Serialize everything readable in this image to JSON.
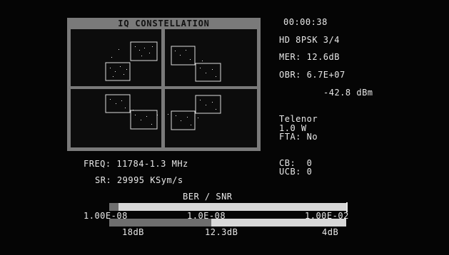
{
  "panel": {
    "title": "IQ CONSTELLATION"
  },
  "status": {
    "time": "00:00:38",
    "mode": "HD 8PSK 3/4",
    "mer": "MER: 12.6dB",
    "obr": "OBR: 6.7E+07",
    "level": "-42.8 dBm",
    "provider": "Telenor",
    "position": "1.0 W",
    "fta": "FTA: No",
    "cb": "CB:  0",
    "ucb": "UCB: 0"
  },
  "tuning": {
    "freq": "FREQ: 11784-1.3 MHz",
    "sr": "SR: 29995 KSym/s"
  },
  "meter": {
    "title": "BER / SNR",
    "ber_left": "1.00E-08",
    "ber_mid": "1.0E-08",
    "ber_right": "1.00E-02",
    "snr_left": "18dB",
    "snr_mid": "12.3dB",
    "snr_right": "4dB",
    "ber_fill_fraction": 0.04,
    "snr_fill_fraction": 0.43
  },
  "colors": {
    "background": "#050505",
    "panel": "#7a7a7a",
    "text": "#e8e8e8",
    "bar_light": "#d8d8d8",
    "bar_dark": "#6e6e6e"
  }
}
